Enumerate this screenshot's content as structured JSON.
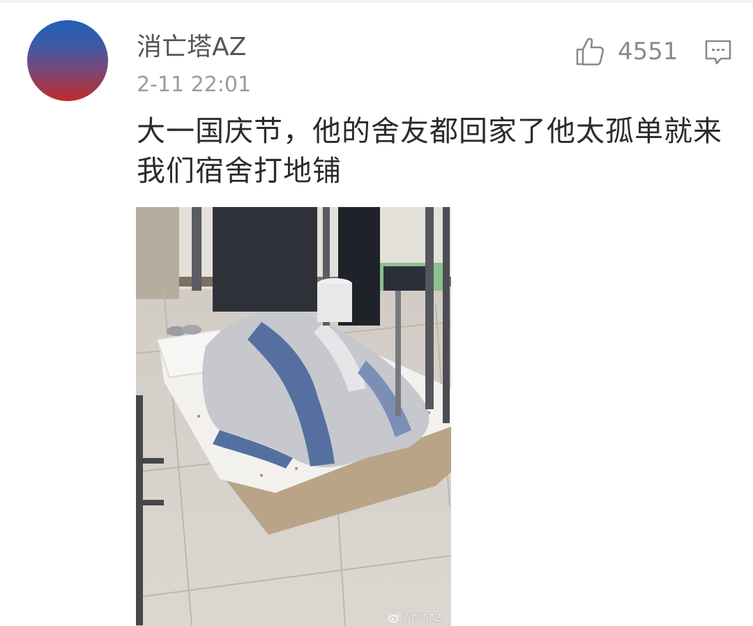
{
  "comment": {
    "username": "消亡塔AZ",
    "timestamp": "2-11 22:01",
    "like_count": "4551",
    "text_line_1": "大一国庆节，他的舍友都回家了他太孤单就来",
    "text_line_2": "我们宿舍打地铺",
    "photo_watermark": "消亡塔AZ"
  },
  "icons": {
    "like": "thumbs-up-icon",
    "reply": "comment-bubble-icon",
    "watermark": "weibo-icon"
  },
  "colors": {
    "avatar_top": "#1f5fb8",
    "avatar_bottom": "#c02a2a",
    "username": "#555555",
    "timestamp": "#9b9b9b",
    "icon": "#8a8a8a"
  }
}
